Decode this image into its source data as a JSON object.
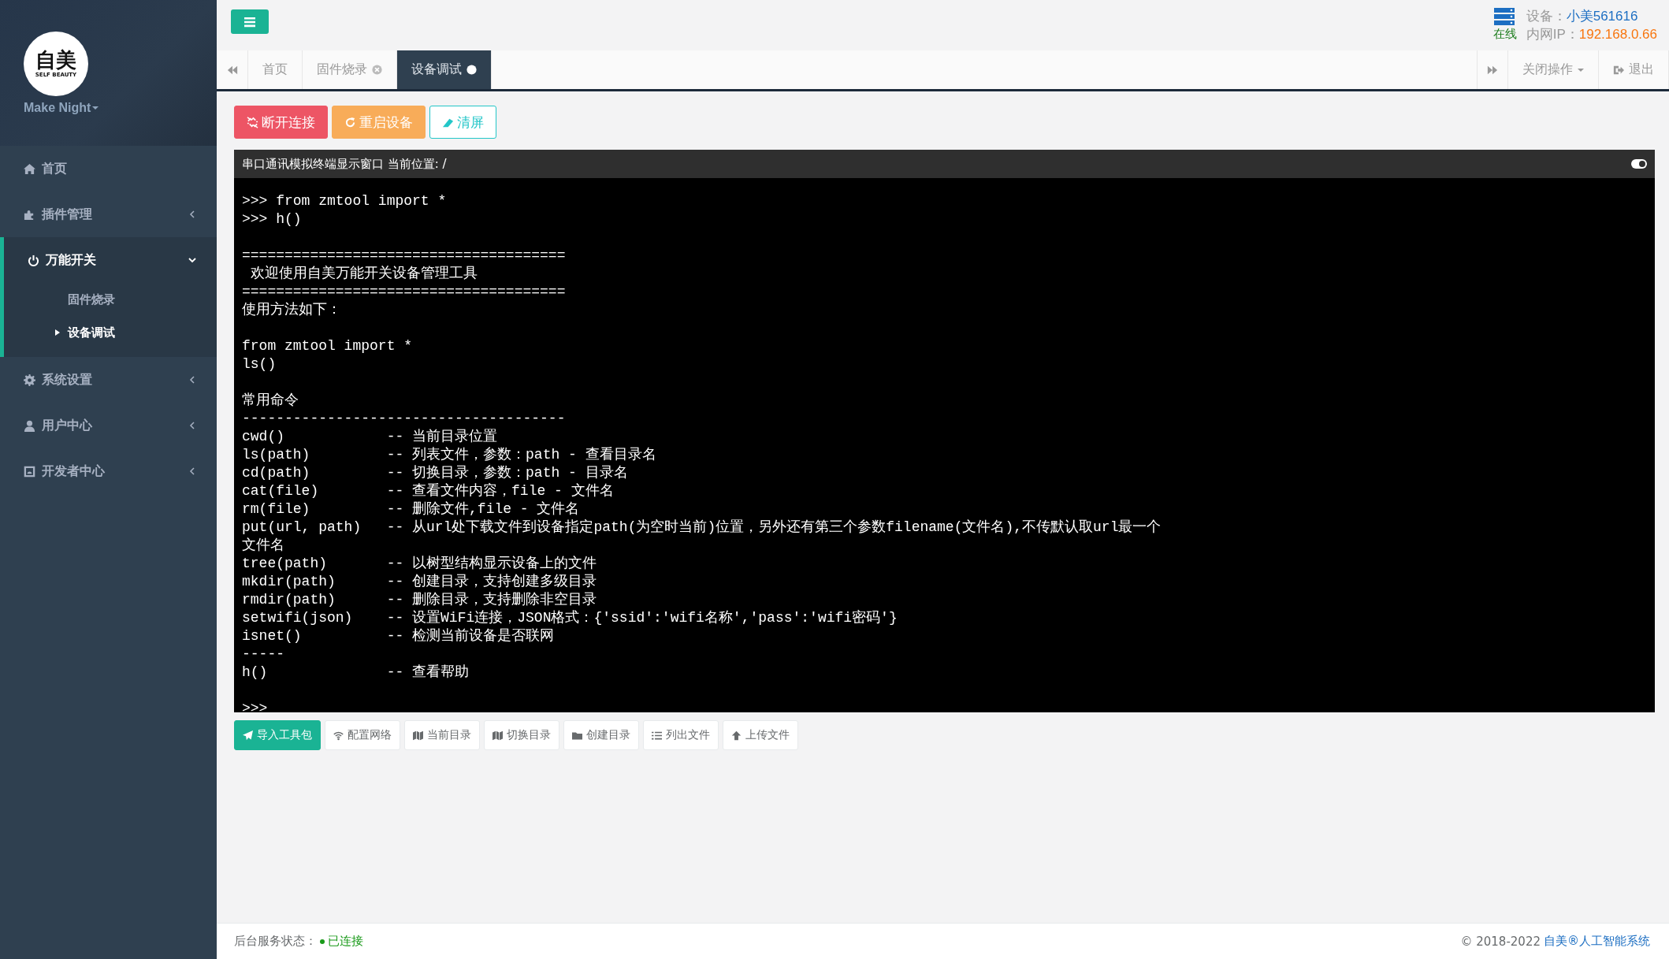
{
  "sidebar": {
    "logo": {
      "mark": "自美",
      "tagline": "SELF BEAUTY"
    },
    "user": "Make Night",
    "items": [
      {
        "label": "首页"
      },
      {
        "label": "插件管理",
        "expanded": false
      },
      {
        "label": "万能开关",
        "expanded": true,
        "children": [
          {
            "label": "固件烧录",
            "selected": false
          },
          {
            "label": "设备调试",
            "selected": true
          }
        ]
      },
      {
        "label": "系统设置",
        "expanded": false
      },
      {
        "label": "用户中心",
        "expanded": false
      },
      {
        "label": "开发者中心",
        "expanded": false
      }
    ]
  },
  "header": {
    "device_label": "设备：",
    "device_name": "小美561616",
    "status": "在线",
    "ip_label": "内网IP：",
    "ip": "192.168.0.66"
  },
  "tabs": [
    {
      "label": "首页",
      "closable": false,
      "selected": false
    },
    {
      "label": "固件烧录",
      "closable": true,
      "selected": false
    },
    {
      "label": "设备调试",
      "closable": true,
      "selected": true
    }
  ],
  "tab_actions": {
    "close_menu": "关闭操作",
    "logout": "退出"
  },
  "actions": [
    {
      "label": "断开连接",
      "kind": "danger"
    },
    {
      "label": "重启设备",
      "kind": "warning"
    },
    {
      "label": "清屏",
      "kind": "outline"
    }
  ],
  "terminal": {
    "title": "串口通讯模拟终端显示窗口 当前位置: /",
    "toggle_on": true,
    "blocks": [
      [
        ">>> from zmtool import *",
        ">>> h()"
      ],
      [
        "======================================",
        " 欢迎使用自美万能开关设备管理工具",
        "======================================",
        "使用方法如下："
      ],
      [
        "from zmtool import *",
        "ls()"
      ],
      [
        "常用命令",
        "--------------------------------------",
        "cwd()            -- 当前目录位置",
        "ls(path)         -- 列表文件，参数：path - 查看目录名",
        "cd(path)         -- 切换目录，参数：path - 目录名",
        "cat(file)        -- 查看文件内容，file - 文件名",
        "rm(file)         -- 删除文件,file - 文件名",
        "put(url, path)   -- 从url处下载文件到设备指定path(为空时当前)位置，另外还有第三个参数filename(文件名),不传默认取url最一个",
        "文件名",
        "tree(path)       -- 以树型结构显示设备上的文件",
        "mkdir(path)      -- 创建目录，支持创建多级目录",
        "rmdir(path)      -- 删除目录，支持删除非空目录",
        "setwifi(json)    -- 设置WiFi连接，JSON格式：{'ssid':'wifi名称','pass':'wifi密码'}",
        "isnet()          -- 检测当前设备是否联网",
        "-----",
        "h()              -- 查看帮助"
      ],
      [
        ">>>"
      ]
    ]
  },
  "tools": [
    {
      "label": "导入工具包",
      "kind": "primary"
    },
    {
      "label": "配置网络",
      "kind": "default"
    },
    {
      "label": "当前目录",
      "kind": "default"
    },
    {
      "label": "切换目录",
      "kind": "default"
    },
    {
      "label": "创建目录",
      "kind": "default"
    },
    {
      "label": "列出文件",
      "kind": "default"
    },
    {
      "label": "上传文件",
      "kind": "default"
    }
  ],
  "footer": {
    "status_label": "后台服务状态：",
    "status": "已连接",
    "connected": true,
    "copyright": "© 2018-2022",
    "link": "自美®人工智能系统"
  }
}
